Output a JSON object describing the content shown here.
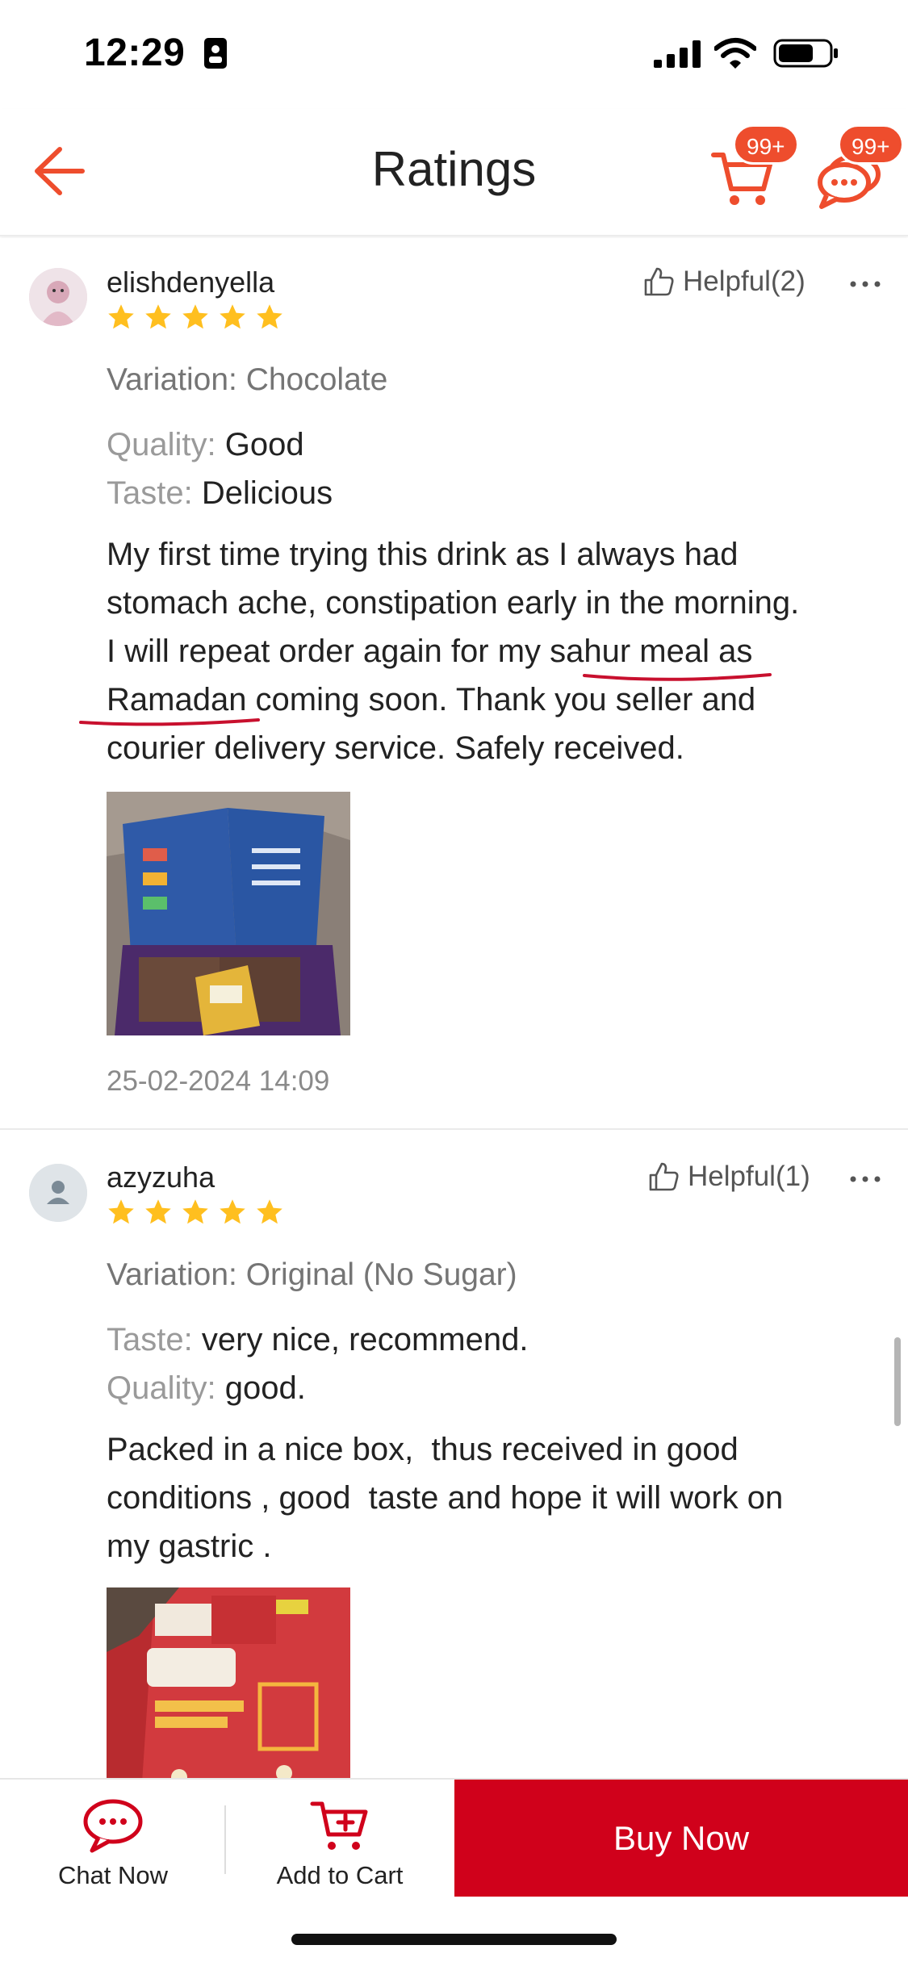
{
  "status_bar": {
    "time": "12:29"
  },
  "header": {
    "title": "Ratings",
    "cart_badge": "99+",
    "chat_badge": "99+"
  },
  "reviews": [
    {
      "username": "elishdenyella",
      "rating": 5,
      "helpful": "Helpful(2)",
      "variation": "Variation: Chocolate",
      "attributes": [
        {
          "key": "Quality:",
          "value": "Good"
        },
        {
          "key": "Taste:",
          "value": "Delicious"
        }
      ],
      "text_lines": [
        "My first time trying this drink as I always had",
        "stomach ache, constipation early in the morning.",
        "I will repeat order again for my sahur meal as",
        "Ramadan coming soon. Thank you seller and",
        "courier delivery service. Safely received."
      ],
      "timestamp": "25-02-2024 14:09"
    },
    {
      "username": "azyzuha",
      "rating": 5,
      "helpful": "Helpful(1)",
      "variation": "Variation: Original (No Sugar)",
      "attributes": [
        {
          "key": "Taste:",
          "value": "very nice, recommend."
        },
        {
          "key": "Quality:",
          "value": "good."
        }
      ],
      "text_lines": [
        "Packed in a nice box,  thus received in good",
        "conditions , good  taste and hope it will work on",
        "my gastric ."
      ]
    }
  ],
  "bottom_bar": {
    "chat_label": "Chat Now",
    "cart_label": "Add to Cart",
    "buy_label": "Buy Now"
  },
  "colors": {
    "accent": "#ee4d2d",
    "buy_button": "#d0011b",
    "star": "#ffbf1f",
    "annotation_underline": "#c8102e"
  },
  "icons": [
    "back-arrow-icon",
    "cart-icon",
    "chat-icon",
    "thumbs-up-icon",
    "more-icon",
    "star-icon",
    "chat-bubble-icon",
    "add-to-cart-icon"
  ]
}
